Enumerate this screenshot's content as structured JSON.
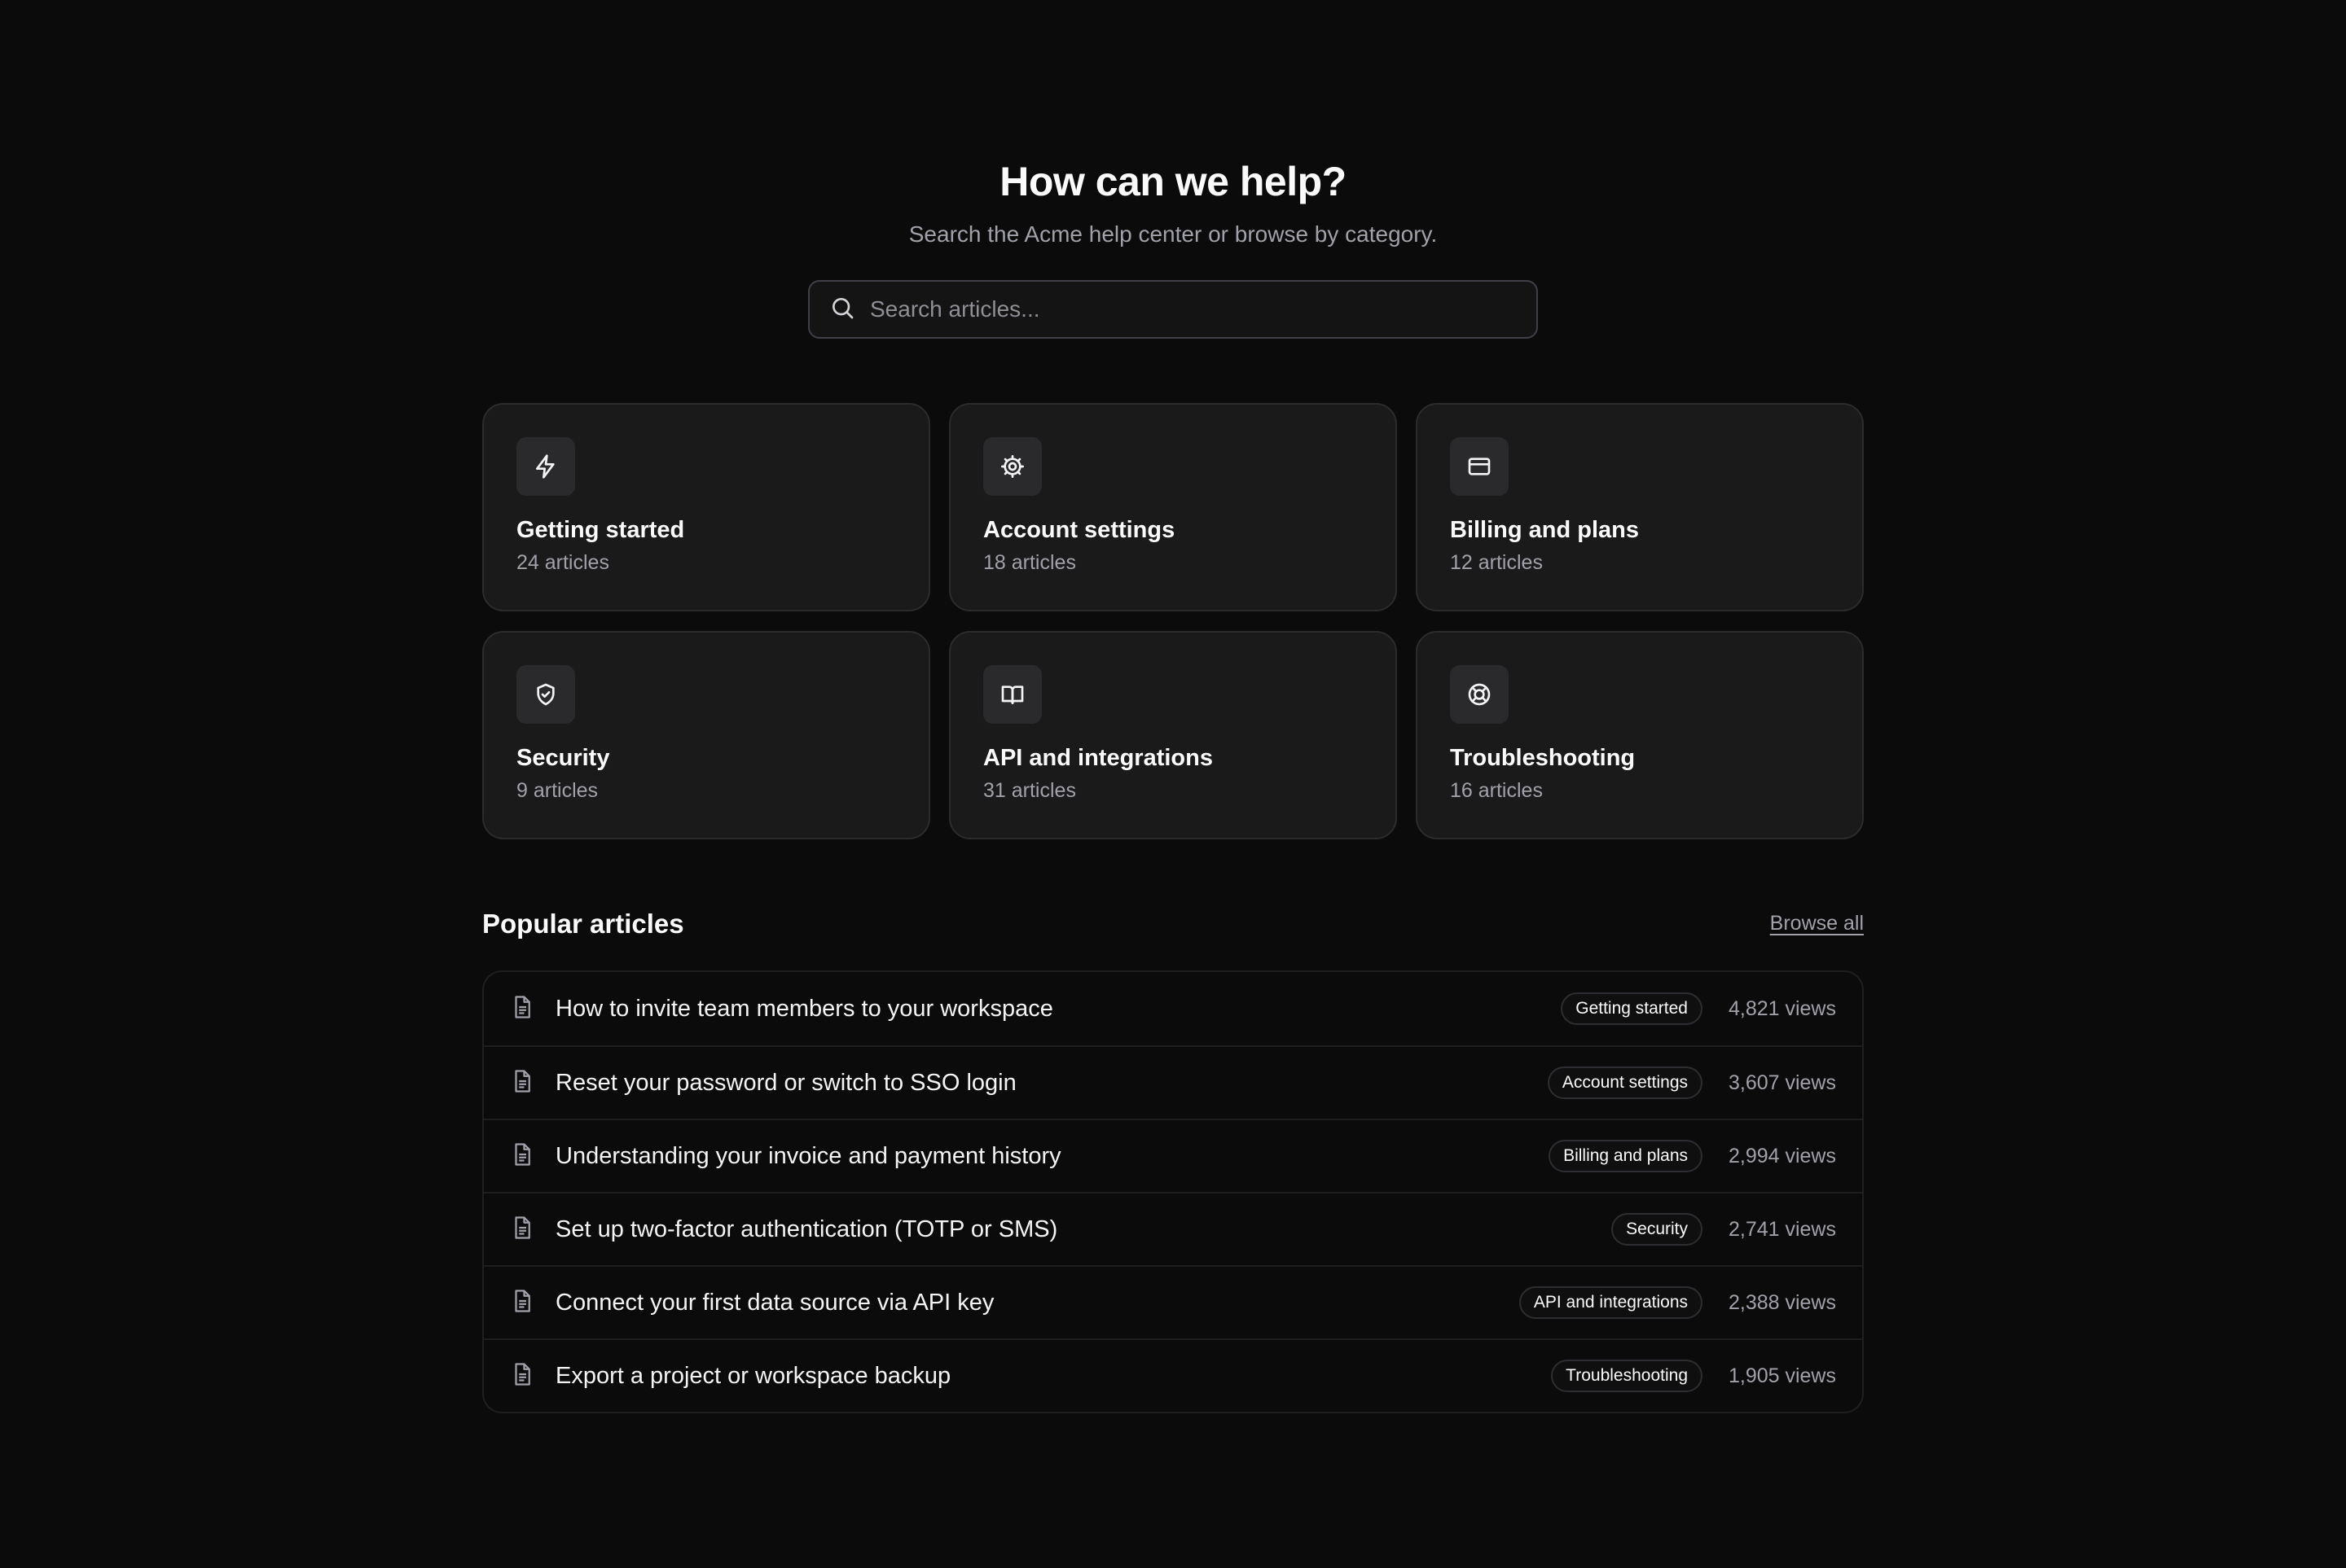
{
  "hero": {
    "title": "How can we help?",
    "subtitle": "Search the Acme help center or browse by category."
  },
  "search": {
    "placeholder": "Search articles...",
    "icon": "search-icon"
  },
  "categories": [
    {
      "icon": "bolt-icon",
      "title": "Getting started",
      "count": "24 articles"
    },
    {
      "icon": "gear-icon",
      "title": "Account settings",
      "count": "18 articles"
    },
    {
      "icon": "credit-card-icon",
      "title": "Billing and plans",
      "count": "12 articles"
    },
    {
      "icon": "shield-icon",
      "title": "Security",
      "count": "9 articles"
    },
    {
      "icon": "book-icon",
      "title": "API and integrations",
      "count": "31 articles"
    },
    {
      "icon": "lifebuoy-icon",
      "title": "Troubleshooting",
      "count": "16 articles"
    }
  ],
  "popular": {
    "title": "Popular articles",
    "browse_label": "Browse all",
    "articles": [
      {
        "title": "How to invite team members to your workspace",
        "category": "Getting started",
        "views": "4,821 views"
      },
      {
        "title": "Reset your password or switch to SSO login",
        "category": "Account settings",
        "views": "3,607 views"
      },
      {
        "title": "Understanding your invoice and payment history",
        "category": "Billing and plans",
        "views": "2,994 views"
      },
      {
        "title": "Set up two-factor authentication (TOTP or SMS)",
        "category": "Security",
        "views": "2,741 views"
      },
      {
        "title": "Connect your first data source via API key",
        "category": "API and integrations",
        "views": "2,388 views"
      },
      {
        "title": "Export a project or workspace backup",
        "category": "Troubleshooting",
        "views": "1,905 views"
      }
    ]
  },
  "colors": {
    "background": "#0b0b0b",
    "card": "#1a1a1a",
    "text_primary": "#fafafa",
    "text_muted": "#a1a1aa"
  }
}
